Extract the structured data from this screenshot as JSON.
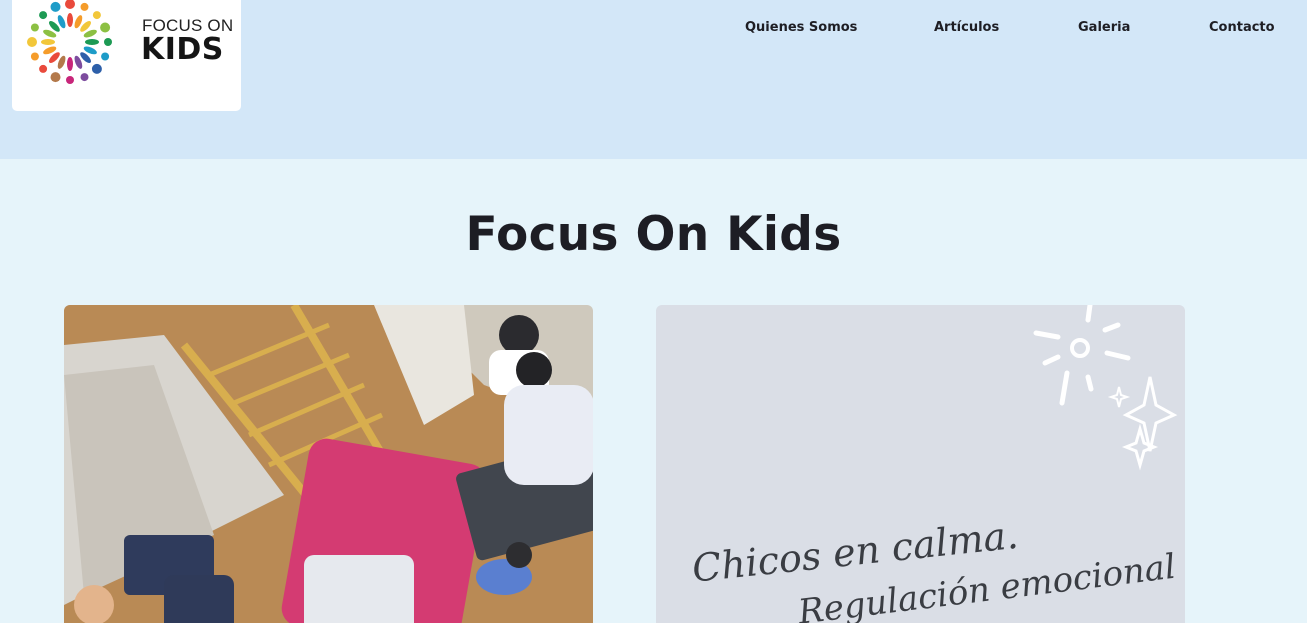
{
  "brand": {
    "logo_line_1": "FOCUS ON",
    "logo_line_2": "KIDS",
    "logo_colors": [
      "#e94a3c",
      "#f59c2a",
      "#f2c73a",
      "#8cc043",
      "#1d9a54",
      "#1e9cc8",
      "#2d5fa9",
      "#7d4c9e",
      "#c8267a",
      "#b3794b"
    ]
  },
  "nav": {
    "items": [
      {
        "label": "Quienes Somos"
      },
      {
        "label": "Artículos"
      },
      {
        "label": "Galeria"
      },
      {
        "label": "Contacto"
      }
    ]
  },
  "main": {
    "title": "Focus On Kids"
  },
  "cards": [
    {
      "image_kind": "photo",
      "caption_line_1": "",
      "caption_line_2": ""
    },
    {
      "image_kind": "graphic",
      "caption_line_1": "Chicos en calma.",
      "caption_line_2": "Regulación emocional"
    }
  ],
  "colors": {
    "header_bg": "#d3e7f8",
    "page_bg": "#e6f4fa",
    "card_graphic_bg": "#dadee6",
    "text": "#1d1d24"
  }
}
